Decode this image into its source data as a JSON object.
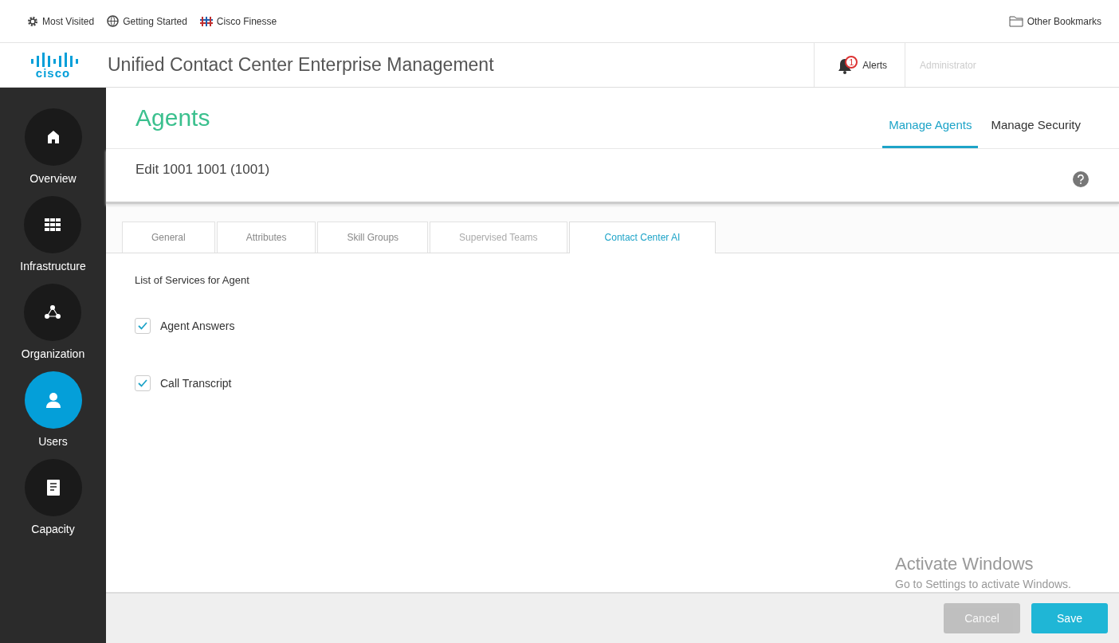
{
  "bookmarks": {
    "items": [
      {
        "label": "Most Visited",
        "kind": "gear"
      },
      {
        "label": "Getting Started",
        "kind": "globe"
      },
      {
        "label": "Cisco Finesse",
        "kind": "cisco"
      }
    ],
    "other": "Other Bookmarks"
  },
  "header": {
    "logo": "cisco",
    "title": "Unified Contact Center Enterprise Management",
    "alerts": {
      "count": "1",
      "label": "Alerts"
    },
    "user": "Administrator"
  },
  "sidebar": {
    "items": [
      {
        "label": "Overview",
        "kind": "home",
        "selected": false
      },
      {
        "label": "Infrastructure",
        "kind": "grid",
        "selected": false
      },
      {
        "label": "Organization",
        "kind": "org",
        "selected": false
      },
      {
        "label": "Users",
        "kind": "user",
        "selected": true
      },
      {
        "label": "Capacity",
        "kind": "doc",
        "selected": false
      }
    ]
  },
  "page": {
    "title": "Agents",
    "nav": [
      {
        "label": "Manage Agents",
        "selected": true
      },
      {
        "label": "Manage Security",
        "selected": false
      }
    ],
    "subtitle": "Edit 1001 1001 (1001)"
  },
  "tabs": [
    {
      "label": "General",
      "selected": false,
      "disabled": false
    },
    {
      "label": "Attributes",
      "selected": false,
      "disabled": false
    },
    {
      "label": "Skill Groups",
      "selected": false,
      "disabled": false
    },
    {
      "label": "Supervised Teams",
      "selected": false,
      "disabled": true
    },
    {
      "label": "Contact Center AI",
      "selected": true,
      "disabled": false
    }
  ],
  "services": {
    "heading": "List of Services for Agent",
    "items": [
      {
        "label": "Agent Answers",
        "checked": true
      },
      {
        "label": "Call Transcript",
        "checked": true
      }
    ]
  },
  "activation": {
    "title": "Activate Windows",
    "hint": "Go to Settings to activate Windows."
  },
  "footer": {
    "buttons": [
      {
        "label": "Cancel",
        "kind": "secondary",
        "disabled": true
      },
      {
        "label": "Save",
        "kind": "primary",
        "disabled": false
      }
    ]
  }
}
